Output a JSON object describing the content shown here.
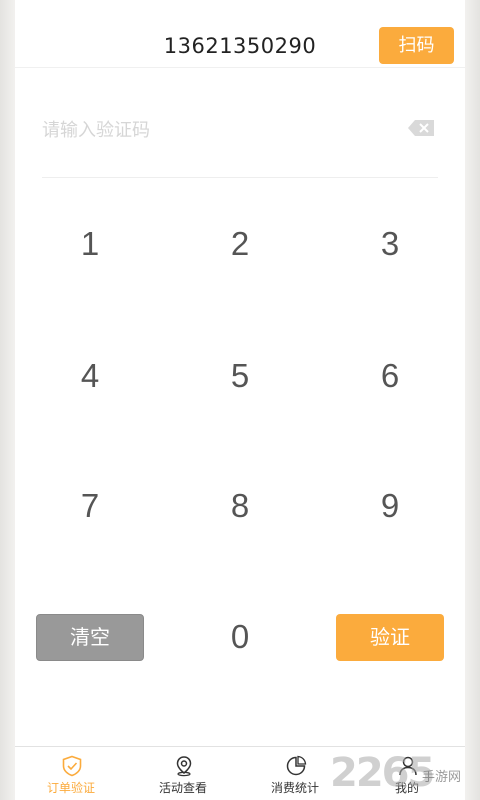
{
  "header": {
    "phone_number": "13621350290",
    "scan_label": "扫码"
  },
  "input": {
    "placeholder": "请输入验证码",
    "value": ""
  },
  "keypad": {
    "keys": [
      "1",
      "2",
      "3",
      "4",
      "5",
      "6",
      "7",
      "8",
      "9",
      "0"
    ],
    "clear_label": "清空",
    "verify_label": "验证"
  },
  "tabbar": {
    "items": [
      {
        "label": "订单验证",
        "icon": "shield-check-icon",
        "active": true
      },
      {
        "label": "活动查看",
        "icon": "location-pin-icon",
        "active": false
      },
      {
        "label": "消费统计",
        "icon": "pie-chart-icon",
        "active": false
      },
      {
        "label": "我的",
        "icon": "person-icon",
        "active": false
      }
    ]
  },
  "watermark": {
    "number": "2265",
    "text": "手游网"
  },
  "colors": {
    "accent": "#fbab3d",
    "clear_button": "#999999",
    "key_text": "#555555"
  }
}
